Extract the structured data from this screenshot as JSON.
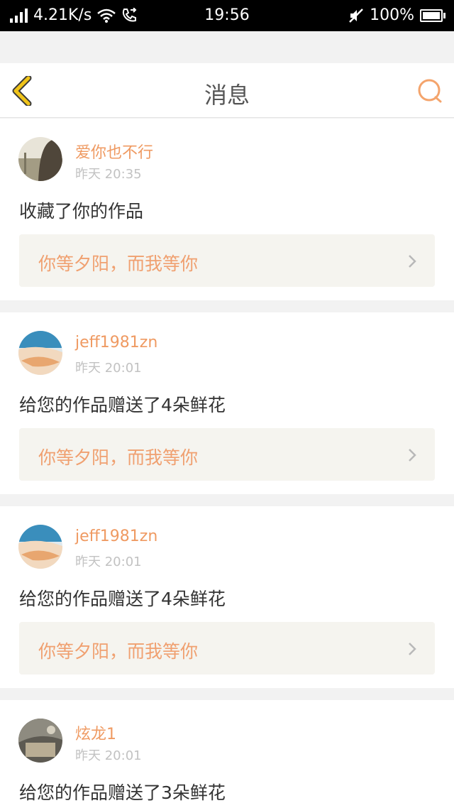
{
  "status_bar": {
    "network_speed": "4.21K/s",
    "time": "19:56",
    "battery": "100%",
    "icons": [
      "signal-icon",
      "wifi-icon",
      "call-forward-icon",
      "mute-icon",
      "battery-icon"
    ]
  },
  "header": {
    "title": "消息",
    "back_icon": "chevron-left-icon",
    "search_icon": "search-icon",
    "accent_color": "#f0c419"
  },
  "messages": [
    {
      "username": "爱你也不行",
      "time": "昨天 20:35",
      "text": "收藏了你的作品",
      "work_title": "你等夕阳，而我等你"
    },
    {
      "username": "jeff1981zn",
      "time": "昨天 20:01",
      "text": "给您的作品赠送了4朵鲜花",
      "work_title": "你等夕阳，而我等你"
    },
    {
      "username": "jeff1981zn",
      "time": "昨天 20:01",
      "text": "给您的作品赠送了4朵鲜花",
      "work_title": "你等夕阳，而我等你"
    },
    {
      "username": "炫龙1",
      "time": "昨天 20:01",
      "text": "给您的作品赠送了3朵鲜花",
      "work_title": ""
    }
  ],
  "colors": {
    "username": "#ef9a62",
    "work_title": "#f0a070",
    "search_icon": "#f4a46c"
  }
}
